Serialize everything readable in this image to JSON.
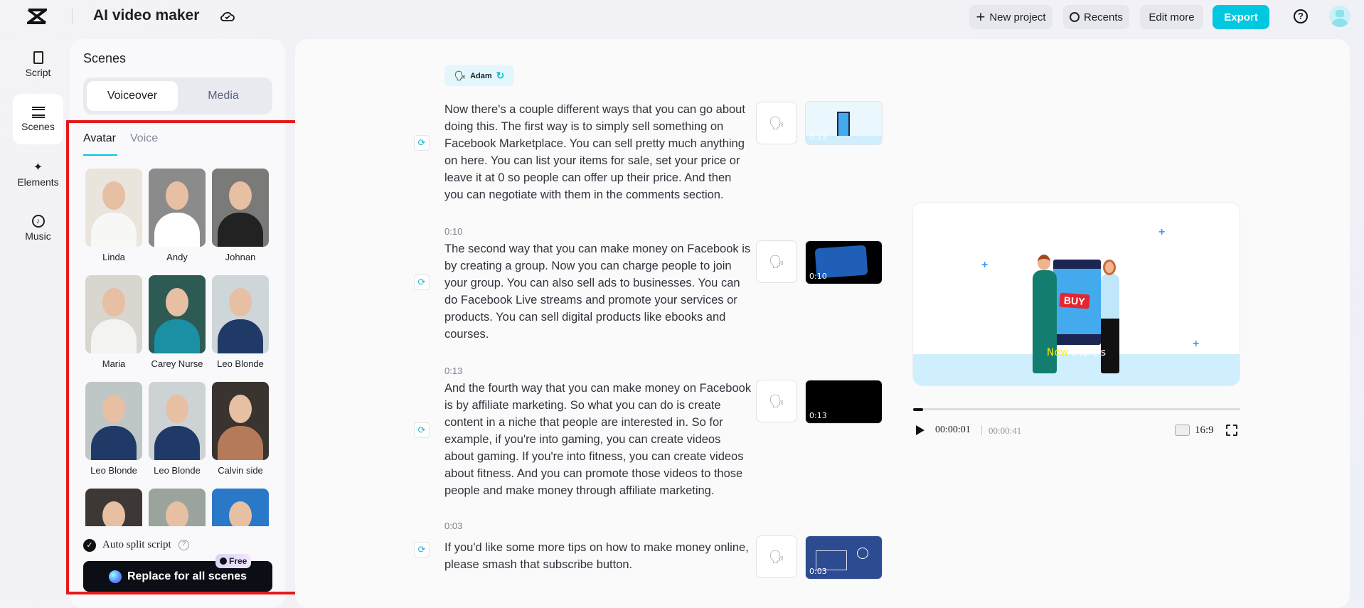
{
  "header": {
    "title": "AI video maker",
    "new_project": "New project",
    "recents": "Recents",
    "edit_more": "Edit more",
    "export": "Export"
  },
  "nav": [
    {
      "label": "Script"
    },
    {
      "label": "Scenes"
    },
    {
      "label": "Elements"
    },
    {
      "label": "Music"
    }
  ],
  "panel": {
    "title": "Scenes",
    "seg_voiceover": "Voiceover",
    "seg_media": "Media",
    "tab_avatar": "Avatar",
    "tab_voice": "Voice",
    "avatars": [
      "Linda",
      "Andy",
      "Johnan",
      "Maria",
      "Carey Nurse",
      "Leo Blonde",
      "Leo Blonde",
      "Leo Blonde",
      "Calvin side",
      "",
      "",
      ""
    ],
    "auto_split": "Auto split script",
    "free_badge": "Free",
    "replace_button": "Replace for all scenes"
  },
  "script": {
    "voice_chip": "Adam",
    "scenes": [
      {
        "time": "",
        "text": "Now there's a couple different ways that you can go about doing this. The first way is to simply sell something on Facebook Marketplace. You can sell pretty much anything on here. You can list your items for sale, set your price or leave it at 0 so people can offer up their price. And then you can negotiate with them in the comments section.",
        "thumb_time": "0:13"
      },
      {
        "time": "0:10",
        "text": "The second way that you can make money on Facebook is by creating a group. Now you can charge people to join your group. You can also sell ads to businesses. You can do Facebook Live streams and promote your services or products. You can sell digital products like ebooks and courses.",
        "thumb_time": "0:10"
      },
      {
        "time": "0:13",
        "text": "And the fourth way that you can make money on Facebook is by affiliate marketing. So what you can do is create content in a niche that people are interested in. So for example, if you're into gaming, you can create videos about gaming. If you're into fitness, you can create videos about fitness. And you can promote those videos to those people and make money through affiliate marketing.",
        "thumb_time": "0:13"
      },
      {
        "time": "0:03",
        "text": "If you'd like some more tips on how to make money online, please smash that subscribe button.",
        "thumb_time": "0:03"
      }
    ]
  },
  "preview": {
    "buy": "BUY",
    "caption_hl": "Now",
    "caption_rest": " there's",
    "current_time": "00:00:01",
    "total_time": "00:00:41",
    "ratio": "16:9",
    "progress": 0.03
  },
  "colors": {
    "accent": "#00c8e0",
    "red": "#e31b1b"
  }
}
